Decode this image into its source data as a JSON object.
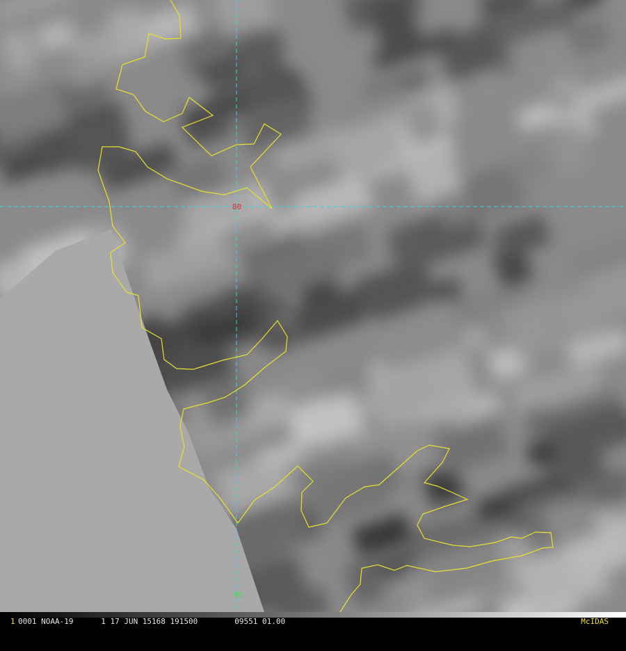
{
  "image": {
    "frame_number": "1",
    "status_text": "0001 NOAA-19      1 17 JUN 15168 191500        09551 01.00",
    "brand": "McIDAS"
  },
  "grid": {
    "latitude_label": "80",
    "longitude_label": "95",
    "line_color": "#40d0e0",
    "lat_label_color": "#e03030",
    "lon_label_color": "#40e040"
  },
  "coastline": {
    "color": "#e8e030"
  },
  "colors": {
    "ocean": "#a9a9a9",
    "land_light": "#9a9a9a",
    "land_dark": "#3a3a3a"
  }
}
